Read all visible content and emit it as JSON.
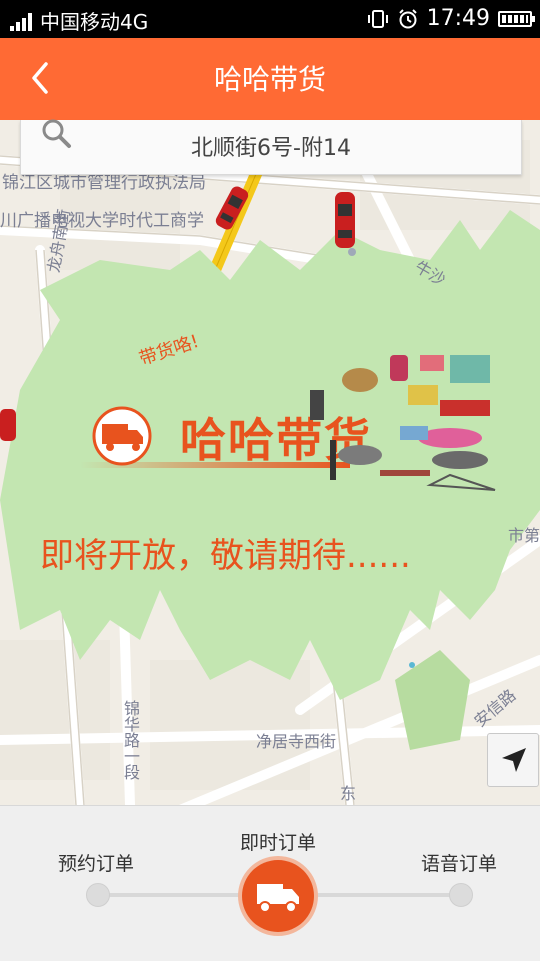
{
  "status": {
    "carrier": "中国移动4G",
    "time": "17:49"
  },
  "titlebar": {
    "title": "哈哈带货"
  },
  "search": {
    "address": "北顺街6号-附14"
  },
  "map": {
    "labels": [
      "锦江区城市管理行政执法局",
      "川广播电视大学时代工商学",
      "龙舟南街",
      "牛沙",
      "市第",
      "锦华路一段",
      "净居寺西街",
      "安信路",
      "东"
    ],
    "promo_slogan": "带货咯!",
    "promo_brand": "哈哈带货",
    "promo_notice": "即将开放，敬请期待......"
  },
  "order_modes": {
    "scheduled": "预约订单",
    "instant": "即时订单",
    "voice": "语音订单",
    "selected": "即时订单"
  },
  "colors": {
    "brand_orange": "#ff6a34",
    "accent_orange": "#e8531e",
    "overlay_green": "#c3e6b1"
  }
}
